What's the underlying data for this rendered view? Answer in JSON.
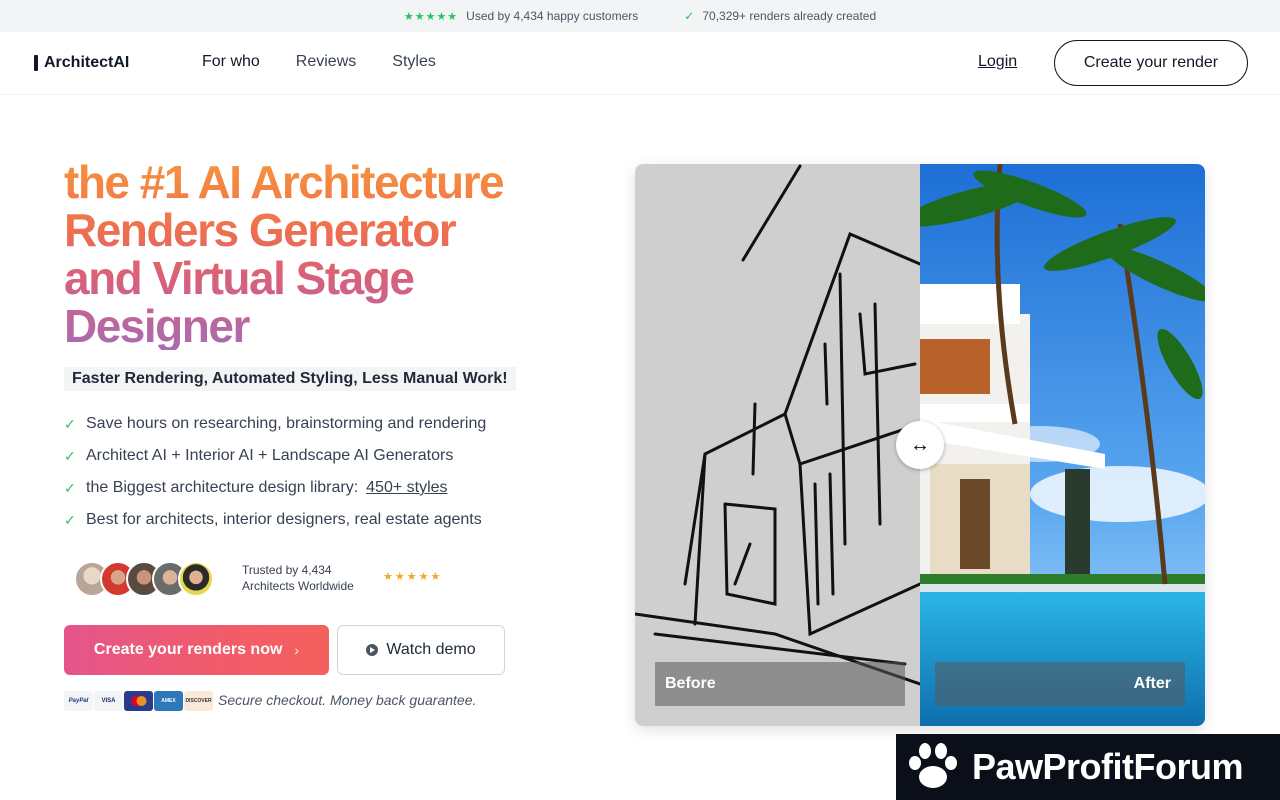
{
  "topbar": {
    "customers_text": "Used by 4,434 happy customers",
    "renders_text": "70,329+ renders already created",
    "stars": "★★★★★",
    "check": "✓"
  },
  "nav": {
    "logo_text": "ArchitectAI",
    "links": [
      "For who",
      "Reviews",
      "Styles"
    ],
    "login": "Login",
    "cta": "Create your render"
  },
  "hero": {
    "headline_lines": [
      "the #1 AI Architecture",
      "Renders Generator",
      "and Virtual Stage",
      "Designer"
    ],
    "tagline": "Faster Rendering, Automated Styling, Less Manual Work!",
    "features": [
      {
        "text": "Save hours on researching, brainstorming and rendering"
      },
      {
        "text": "Architect AI + Interior AI + Landscape AI Generators"
      },
      {
        "text": "the Biggest architecture design library:",
        "link": "450+ styles"
      },
      {
        "text": "Best for architects, interior designers, real estate agents"
      }
    ],
    "trust_line1": "Trusted by 4,434",
    "trust_line2": "Architects Worldwide",
    "trust_stars": "★★★★★",
    "primary_button": "Create your renders now",
    "primary_chevron": "›",
    "secondary_button": "Watch demo",
    "payments": [
      "PayPal",
      "VISA",
      "Mastercard",
      "AMEX",
      "DISCOVER"
    ],
    "secure_text": "Secure checkout. Money back guarantee."
  },
  "compare": {
    "before_label": "Before",
    "after_label": "After",
    "handle_glyph": "↔"
  },
  "watermark": {
    "text": "PawProfitForum"
  },
  "colors": {
    "accent_green": "#22c55e",
    "star_gold": "#f5a623",
    "cta_gradient_start": "#e4558a",
    "cta_gradient_end": "#f4605c",
    "headline_orange": "#f7943c",
    "headline_purple": "#a86bb3"
  }
}
